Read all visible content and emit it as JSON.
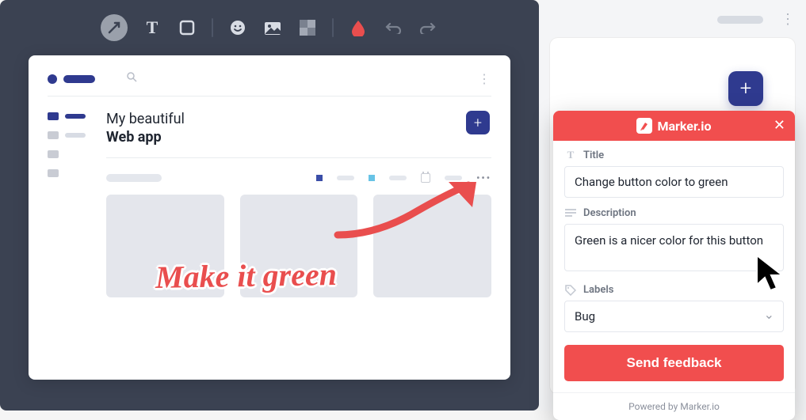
{
  "toolbar": {
    "arrow": "arrow",
    "text": "T",
    "rect": "rect",
    "emoji": "emoji",
    "image": "image",
    "blur": "blur",
    "color": "color",
    "undo": "undo",
    "redo": "redo"
  },
  "app": {
    "heading_line1": "My beautiful",
    "heading_line2": "Web app",
    "search_placeholder": "",
    "add": "+"
  },
  "annotation": {
    "text": "Make it green"
  },
  "panel": {
    "brand": "Marker.io",
    "title_label": "Title",
    "title_value": "Change button color to green",
    "description_label": "Description",
    "description_value": "Green is a nicer color for this button",
    "labels_label": "Labels",
    "labels_value": "Bug",
    "submit": "Send feedback",
    "footer": "Powered by Marker.io"
  },
  "fab": "+",
  "colors": {
    "accent": "#f14e4e",
    "dark": "#2f3a8f",
    "editor_bg": "#3b4252"
  }
}
